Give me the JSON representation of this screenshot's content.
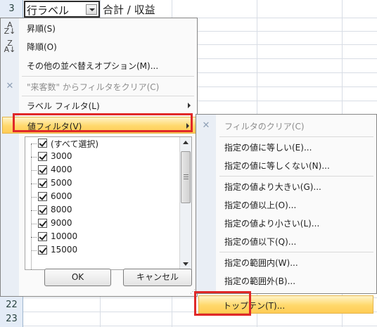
{
  "sheet": {
    "row_numbers": [
      "3",
      "22",
      "23"
    ],
    "pivot_row_label": "行ラベル",
    "value_header": "合計 / 収益"
  },
  "menu": {
    "items": [
      {
        "label": "昇順(S)",
        "icon": "sort-ascending-icon",
        "enabled": true
      },
      {
        "label": "降順(O)",
        "icon": "sort-descending-icon",
        "enabled": true
      },
      {
        "label": "その他の並べ替えオプション(M)...",
        "enabled": true
      },
      {
        "label": "\"来客数\" からフィルタをクリア(C)",
        "icon": "clear-filter-icon",
        "enabled": false
      },
      {
        "label": "ラベル フィルタ(L)",
        "submenu": true,
        "enabled": true
      },
      {
        "label": "値フィルタ(V)",
        "submenu": true,
        "enabled": true,
        "highlighted": true
      }
    ],
    "list_items": [
      "(すべて選択)",
      "3000",
      "4000",
      "5000",
      "6000",
      "8000",
      "9000",
      "10000",
      "15000"
    ],
    "ok_label": "OK",
    "cancel_label": "キャンセル"
  },
  "submenu": {
    "items": [
      {
        "label": "フィルタのクリア(C)",
        "icon": "clear-filter-icon",
        "enabled": false
      },
      {
        "label": "指定の値に等しい(E)...",
        "enabled": true
      },
      {
        "label": "指定の値に等しくない(N)...",
        "enabled": true
      },
      {
        "label": "指定の値より大きい(G)...",
        "enabled": true
      },
      {
        "label": "指定の値以上(O)...",
        "enabled": true
      },
      {
        "label": "指定の値より小さい(L)...",
        "enabled": true
      },
      {
        "label": "指定の値以下(Q)...",
        "enabled": true
      },
      {
        "label": "指定の範囲内(W)...",
        "enabled": true
      },
      {
        "label": "指定の範囲外(B)...",
        "enabled": true
      },
      {
        "label": "トップテン(T)...",
        "enabled": true,
        "highlighted": true
      }
    ]
  },
  "colors": {
    "highlight_gradient_mid": "#ffd86b",
    "annotation_red": "#e02828",
    "row_header_bg": "#e4ecf7"
  }
}
